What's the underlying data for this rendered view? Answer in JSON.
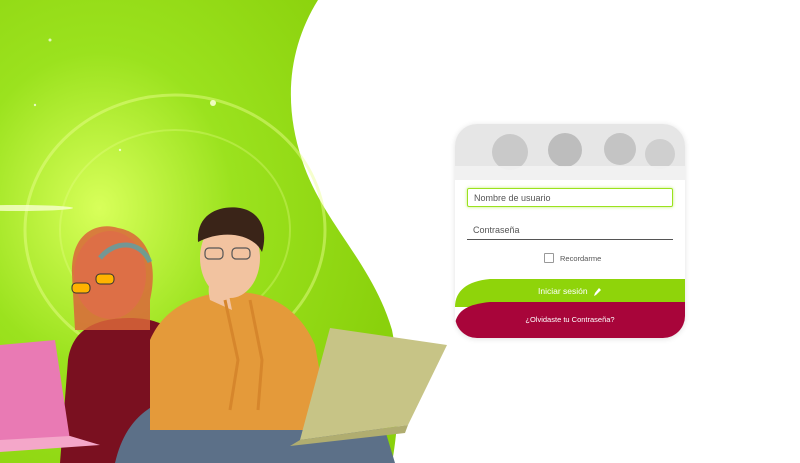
{
  "login": {
    "username_placeholder": "Nombre de usuario",
    "password_placeholder": "Contraseña",
    "remember_label": "Recordarme",
    "login_button": "Iniciar sesión",
    "forgot_link": "¿Olvidaste tu Contraseña?"
  },
  "colors": {
    "brand_green": "#8fd40a",
    "brand_crimson": "#a8053a",
    "background": "#ffffff"
  },
  "icons": {
    "login_button_icon": "pencil-arrow-icon"
  }
}
